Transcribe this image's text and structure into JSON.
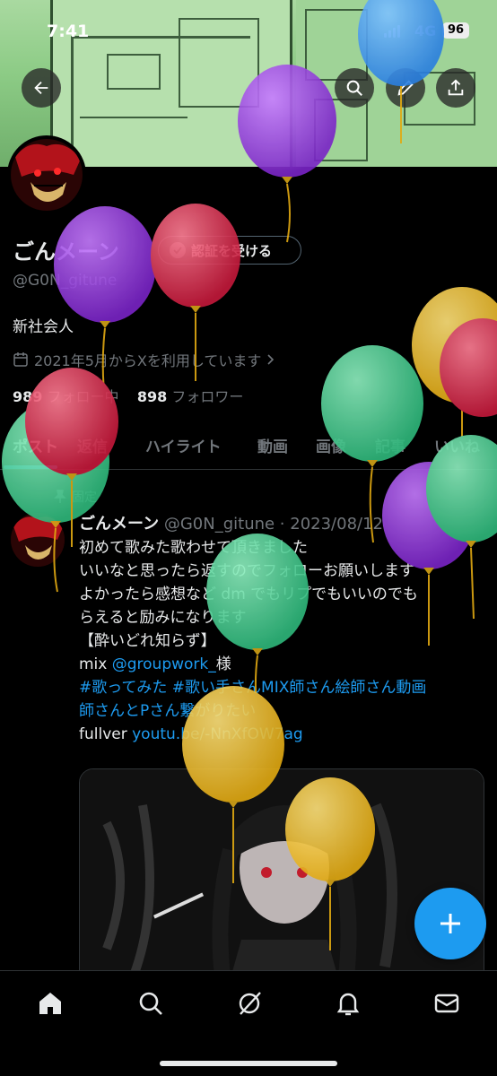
{
  "status_bar": {
    "time": "7:41",
    "network": "4G",
    "battery": "96"
  },
  "profile": {
    "name": "ごんメーン",
    "handle": "@G0N_gitune",
    "verify_label": "認証を受ける",
    "bio": "新社会人",
    "joined": "2021年5月からXを利用しています",
    "following_count": "989",
    "following_label": "フォロー中",
    "followers_count": "898",
    "followers_label": "フォロワー"
  },
  "tabs": [
    {
      "label": "ポスト"
    },
    {
      "label": "返信"
    },
    {
      "label": "ハイライト"
    },
    {
      "label": "動画"
    },
    {
      "label": "画像"
    },
    {
      "label": "記事"
    },
    {
      "label": "いいね"
    }
  ],
  "post": {
    "pinned_label": "固定",
    "author": "ごんメーン",
    "meta": "@G0N_gitune · 2023/08/12",
    "lines": [
      "初めて歌みた歌わせて頂きました",
      "いいなと思ったら返すのでフォローお願いします",
      "よかったら感想など dm でもリプでもいいのでも",
      "らえると励みになります",
      "【酔いどれ知らず】"
    ],
    "mix_prefix": "mix ",
    "mix_link": "@groupwork_",
    "mix_suffix": "様",
    "hashtag_line1": "#歌ってみた #歌い手さんMIX師さん絵師さん動画",
    "hashtag_line2": "師さんとPさん繋がりたい",
    "fullver_prefix": " fullver ",
    "fullver_link": "youtu.be/-NnXfOW7ag"
  },
  "icons": {
    "back": "back-arrow-icon",
    "search": "search-icon",
    "edit": "pencil-icon",
    "share": "share-icon",
    "compose": "plus-icon",
    "home": "home-icon",
    "explore": "search-icon",
    "grok": "grok-icon",
    "notifications": "bell-icon",
    "messages": "mail-icon"
  },
  "colors": {
    "accent": "#1d9bf0",
    "muted": "#71767b",
    "text": "#e7e9ea"
  }
}
